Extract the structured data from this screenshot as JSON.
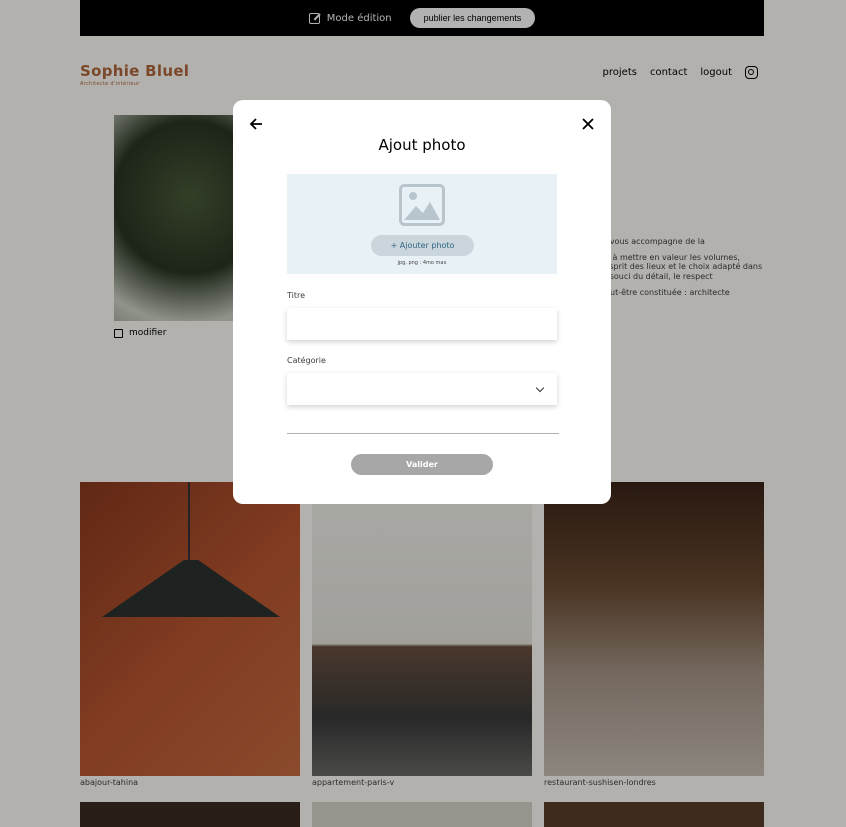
{
  "edit_bar": {
    "mode_label": "Mode édition",
    "publish_label": "publier les changements"
  },
  "header": {
    "logo_title": "Sophie Bluel",
    "logo_subtitle": "Architecte d'intérieur",
    "nav": [
      "projets",
      "contact",
      "logout"
    ],
    "instagram_icon": "instagram-icon"
  },
  "intro": {
    "modify_label": "modifier",
    "text_lines": [
      "Je vous accompagne de la",
      "on à mettre en valeur les volumes, l'esprit des lieux et le choix adapté dans le souci du détail, le respect",
      "peut-être constituée : architecte"
    ]
  },
  "gallery": {
    "captions": [
      "abajour-tahina",
      "appartement-paris-v",
      "restaurant-sushisen-londres"
    ]
  },
  "modal": {
    "title": "Ajout photo",
    "add_photo_label": "+ Ajouter photo",
    "upload_hint": "jpg, png : 4mo max",
    "title_label": "Titre",
    "title_value": "",
    "category_label": "Catégorie",
    "category_value": "",
    "validate_label": "Valider"
  },
  "colors": {
    "brand": "#b1663c",
    "upload_bg": "#e8f1f6",
    "add_photo_bg": "#cbd6dc",
    "add_photo_text": "#306685",
    "validate_bg": "#a7a7a7"
  }
}
